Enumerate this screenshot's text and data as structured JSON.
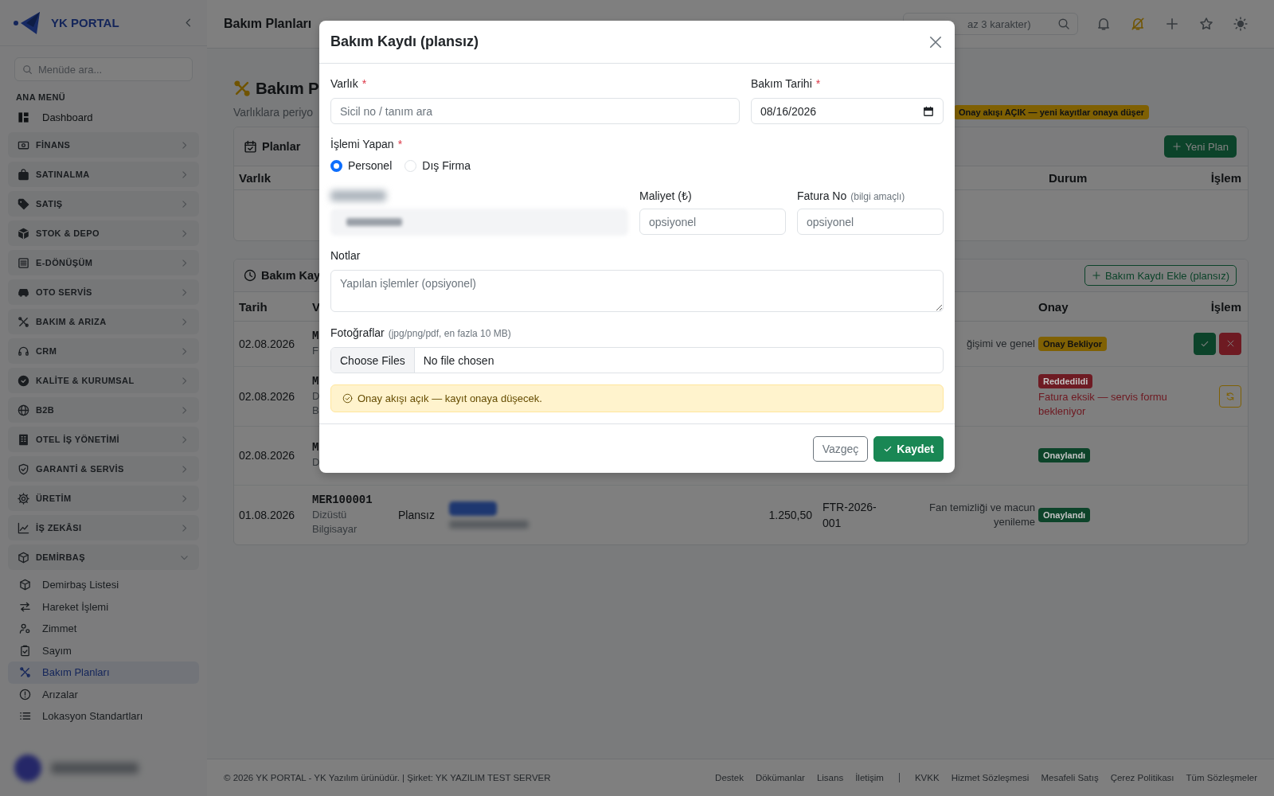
{
  "sidebar": {
    "brand": "YK PORTAL",
    "search": {
      "placeholder": "Menüde ara..."
    },
    "section": "ANA MENÜ",
    "dashboard": "Dashboard",
    "groups": [
      {
        "label": "FİNANS",
        "expanded": false
      },
      {
        "label": "SATINALMA",
        "expanded": false
      },
      {
        "label": "SATIŞ",
        "expanded": false
      },
      {
        "label": "STOK & DEPO",
        "expanded": false
      },
      {
        "label": "E-DÖNÜŞÜM",
        "expanded": false
      },
      {
        "label": "OTO SERVİS",
        "expanded": false
      },
      {
        "label": "BAKIM & ARIZA",
        "expanded": false
      },
      {
        "label": "CRM",
        "expanded": false
      },
      {
        "label": "KALİTE & KURUMSAL",
        "expanded": false
      },
      {
        "label": "B2B",
        "expanded": false
      },
      {
        "label": "OTEL İŞ YÖNETİMİ",
        "expanded": false
      },
      {
        "label": "GARANTİ & SERVİS",
        "expanded": false
      },
      {
        "label": "ÜRETİM",
        "expanded": false
      },
      {
        "label": "İŞ ZEKÂSI",
        "expanded": false
      },
      {
        "label": "DEMİRBAŞ",
        "expanded": true,
        "children": [
          {
            "label": "Demirbaş Listesi",
            "selected": false
          },
          {
            "label": "Hareket İşlemi",
            "selected": false
          },
          {
            "label": "Zimmet",
            "selected": false
          },
          {
            "label": "Sayım",
            "selected": false
          },
          {
            "label": "Bakım Planları",
            "selected": true
          },
          {
            "label": "Arızalar",
            "selected": false
          },
          {
            "label": "Lokasyon Standartları",
            "selected": false
          }
        ]
      }
    ],
    "user": {
      "kind": "blurred"
    }
  },
  "topbar": {
    "title": "Bakım Planları",
    "search": {
      "placeholder": "az 3 karakter)"
    }
  },
  "page": {
    "title": "Bakım P",
    "subtitle": "Varlıklara periyo",
    "approval_badge": "Onay akışı AÇIK — yeni kayıtlar onaya düşer",
    "plans": {
      "title": "Planlar",
      "new_button": "Yeni Plan",
      "columns": [
        "Varlık",
        "Durum",
        "İşlem"
      ]
    },
    "records": {
      "title": "Bakım Kay",
      "add_button": "Bakım Kaydı Ekle (plansız)",
      "columns": [
        "Tarih",
        "V",
        "Onay",
        "İşlem"
      ],
      "rows": [
        {
          "date": "02.08.2026",
          "asset_code": "M",
          "asset_name": [
            "F"
          ],
          "description": "ğişimi ve genel",
          "approval": {
            "label": "Onay Bekliyor",
            "color": "#806104"
          },
          "actions": {
            "kind": "review"
          }
        },
        {
          "date": "02.08.2026",
          "asset_code": "M",
          "asset_name": [
            "D",
            "B"
          ],
          "approval": {
            "label": "Reddedildi",
            "color": "#6e1b23",
            "note": "Fatura eksik — servis formu bekleniyor"
          },
          "actions": {
            "kind": "retry"
          }
        },
        {
          "date": "02.08.2026",
          "asset_code": "M",
          "asset_name": [
            "D"
          ],
          "approval": {
            "label": "Onaylandı",
            "color": "#0d442a"
          }
        },
        {
          "date": "01.08.2026",
          "asset_code": "MER100001",
          "asset_name": [
            "Dizüstü",
            "Bilgisayar"
          ],
          "type": "Plansız",
          "performer": {
            "kind": "blurred"
          },
          "cost": "1.250,50",
          "invoice": "FTR-2026-001",
          "description": "Fan temizliği ve macun yenileme",
          "approval": {
            "label": "Onaylandı",
            "color": "#0d442a"
          }
        }
      ]
    }
  },
  "modal": {
    "title": "Bakım Kaydı (plansız)",
    "asset": {
      "label": "Varlık",
      "required_mark": "*",
      "placeholder": "Sicil no / tanım ara"
    },
    "date": {
      "label": "Bakım Tarihi",
      "required_mark": "*",
      "value": "08/16/2026"
    },
    "performer": {
      "label": "İşlemi Yapan",
      "required_mark": "*",
      "options": [
        {
          "label": "Personel",
          "selected": true
        },
        {
          "label": "Dış Firma",
          "selected": false
        }
      ]
    },
    "staff_field": {
      "kind": "blurred"
    },
    "cost": {
      "label": "Maliyet (₺)",
      "placeholder": "opsiyonel"
    },
    "invoice": {
      "label": "Fatura No",
      "hint": "(bilgi amaçlı)",
      "placeholder": "opsiyonel"
    },
    "notes": {
      "label": "Notlar",
      "placeholder": "Yapılan işlemler (opsiyonel)"
    },
    "photos": {
      "label": "Fotoğraflar",
      "hint": "(jpg/png/pdf, en fazla 10 MB)",
      "button": "Choose Files",
      "status": "No file chosen"
    },
    "alert": "Onay akışı açık — kayıt onaya düşecek.",
    "buttons": {
      "cancel": "Vazgeç",
      "save": "Kaydet"
    }
  },
  "footer": {
    "copyright": "© 2026 YK PORTAL - YK Yazılım ürünüdür. | Şirket: YK YAZILIM TEST SERVER",
    "links": [
      "Destek",
      "Dökümanlar",
      "Lisans",
      "İletişim"
    ],
    "legal_links": [
      "KVKK",
      "Hizmet Sözleşmesi",
      "Mesafeli Satış",
      "Çerez Politikası",
      "Tüm Sözleşmeler"
    ]
  }
}
